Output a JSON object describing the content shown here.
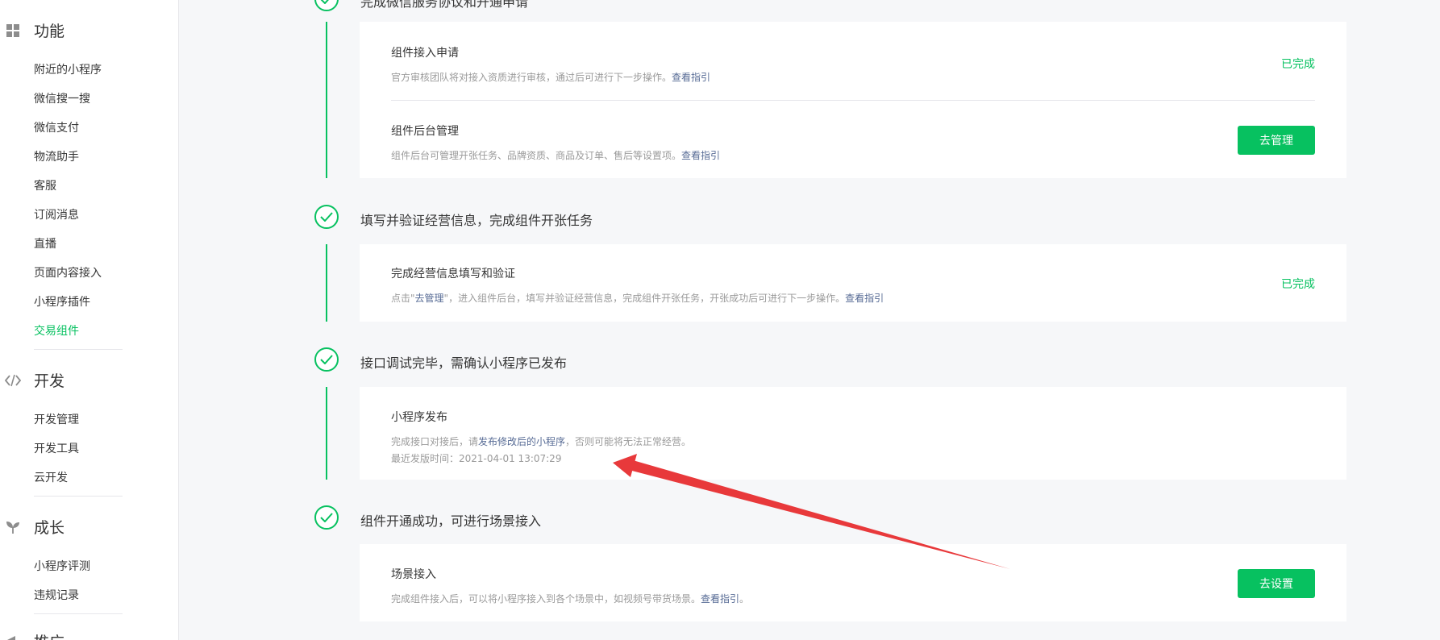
{
  "sidebar": {
    "sections": [
      {
        "title": "功能",
        "icon": "grid-icon",
        "items": [
          "附近的小程序",
          "微信搜一搜",
          "微信支付",
          "物流助手",
          "客服",
          "订阅消息",
          "直播",
          "页面内容接入",
          "小程序插件",
          "交易组件"
        ],
        "active_item": "交易组件"
      },
      {
        "title": "开发",
        "icon": "code-icon",
        "items": [
          "开发管理",
          "开发工具",
          "云开发"
        ]
      },
      {
        "title": "成长",
        "icon": "sprout-icon",
        "items": [
          "小程序评测",
          "违规记录"
        ]
      },
      {
        "title": "推广",
        "icon": "megaphone-icon"
      }
    ]
  },
  "steps": [
    {
      "title": "完成微信服务协议和开通申请",
      "rows": [
        {
          "title": "组件接入申请",
          "desc": "官方审核团队将对接入资质进行审核，通过后可进行下一步操作。",
          "link": "查看指引",
          "status": "已完成"
        },
        {
          "title": "组件后台管理",
          "desc": "组件后台可管理开张任务、品牌资质、商品及订单、售后等设置项。",
          "link": "查看指引",
          "button": "去管理"
        }
      ]
    },
    {
      "title": "填写并验证经营信息，完成组件开张任务",
      "rows": [
        {
          "title": "完成经营信息填写和验证",
          "desc_pre": "点击\"",
          "desc_link": "去管理",
          "desc_mid": "\"，进入组件后台，填写并验证经营信息，完成组件开张任务，开张成功后可进行下一步操作。",
          "link": "查看指引",
          "status": "已完成"
        }
      ]
    },
    {
      "title": "接口调试完毕，需确认小程序已发布",
      "rows": [
        {
          "title": "小程序发布",
          "desc_pre": "完成接口对接后，请",
          "desc_link": "发布修改后的小程序",
          "desc_post": "，否则可能将无法正常经营。",
          "desc2": "最近发版时间：2021-04-01 13:07:29"
        }
      ]
    },
    {
      "title": "组件开通成功，可进行场景接入",
      "rows": [
        {
          "title": "场景接入",
          "desc": "完成组件接入后，可以将小程序接入到各个场景中，如视频号带货场景。",
          "link": "查看指引",
          "link_suffix": "。",
          "button": "去设置"
        }
      ]
    }
  ],
  "colors": {
    "accent": "#07c160",
    "link": "#576b95",
    "annotation": "#e8393b"
  }
}
